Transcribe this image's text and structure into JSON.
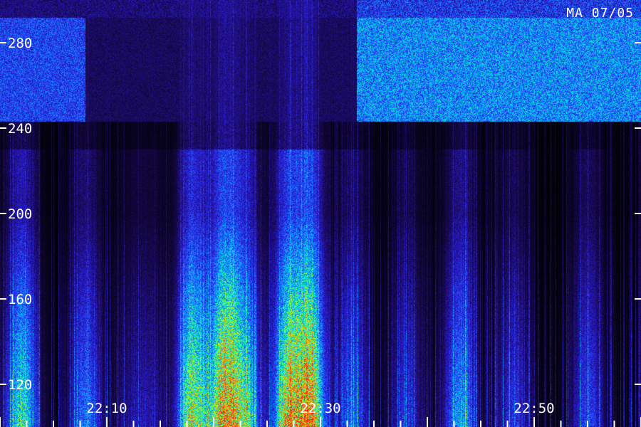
{
  "chart_data": {
    "type": "heatmap",
    "title": "",
    "label": "MA 07/05",
    "xlabel": "",
    "ylabel": "",
    "x_ticks": [
      "22:10",
      "22:30",
      "22:50"
    ],
    "y_ticks": [
      120,
      160,
      200,
      240,
      280
    ],
    "ylim": [
      100,
      300
    ],
    "colormap": [
      "#000000",
      "#1a0a5c",
      "#2a1cd8",
      "#1f5cff",
      "#00c8ff",
      "#20ff8c",
      "#c8ff00",
      "#ff9000",
      "#ff2020"
    ],
    "intensity_by_time": [
      {
        "t": "22:02",
        "v": 0.65
      },
      {
        "t": "22:08",
        "v": 0.45
      },
      {
        "t": "22:12",
        "v": 0.15
      },
      {
        "t": "22:14",
        "v": 0.2
      },
      {
        "t": "22:18",
        "v": 0.8
      },
      {
        "t": "22:21",
        "v": 0.95
      },
      {
        "t": "22:23",
        "v": 0.55
      },
      {
        "t": "22:27",
        "v": 0.85
      },
      {
        "t": "22:29",
        "v": 0.9
      },
      {
        "t": "22:33",
        "v": 0.4
      },
      {
        "t": "22:38",
        "v": 0.3
      },
      {
        "t": "22:43",
        "v": 0.5
      },
      {
        "t": "22:48",
        "v": 0.3
      },
      {
        "t": "22:55",
        "v": 0.35
      }
    ]
  }
}
